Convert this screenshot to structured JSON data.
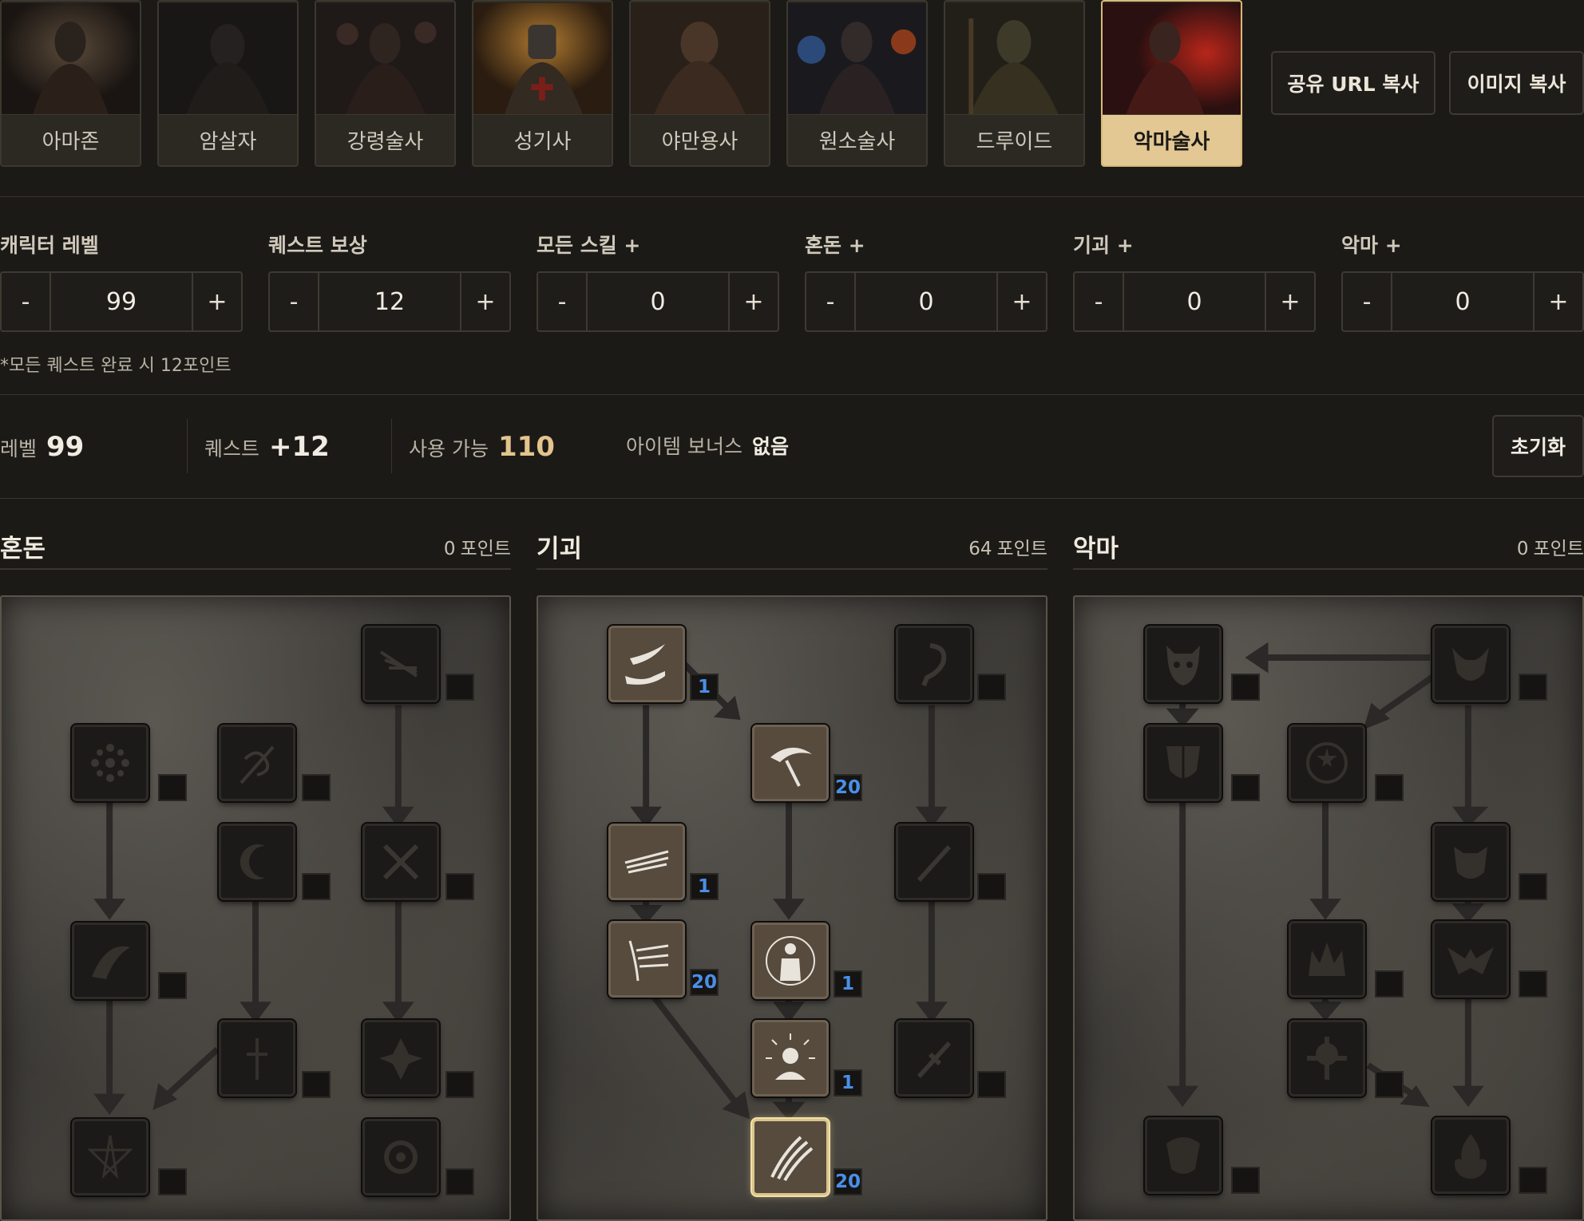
{
  "classes": [
    {
      "name": "아마존",
      "active": false
    },
    {
      "name": "암살자",
      "active": false
    },
    {
      "name": "강령술사",
      "active": false
    },
    {
      "name": "성기사",
      "active": false
    },
    {
      "name": "야만용사",
      "active": false
    },
    {
      "name": "원소술사",
      "active": false
    },
    {
      "name": "드루이드",
      "active": false
    },
    {
      "name": "악마술사",
      "active": true
    }
  ],
  "top_buttons": {
    "share_url": "공유 URL 복사",
    "copy_image": "이미지 복사"
  },
  "steppers": [
    {
      "label": "캐릭터 레벨",
      "value": "99"
    },
    {
      "label": "퀘스트 보상",
      "value": "12"
    },
    {
      "label": "모든 스킬 +",
      "value": "0"
    },
    {
      "label": "혼돈 +",
      "value": "0"
    },
    {
      "label": "기괴 +",
      "value": "0"
    },
    {
      "label": "악마 +",
      "value": "0"
    }
  ],
  "stepper_symbols": {
    "minus": "-",
    "plus": "+"
  },
  "note": "*모든 퀘스트 완료 시 12포인트",
  "summary": {
    "level_label": "레벨",
    "level_value": "99",
    "quest_label": "퀘스트",
    "quest_value": "+12",
    "available_label": "사용 가능",
    "available_value": "110",
    "item_bonus_label": "아이템 보너스",
    "item_bonus_value": "없음",
    "reset": "초기화"
  },
  "trees": [
    {
      "name": "혼돈",
      "points": "0",
      "points_unit": "포인트"
    },
    {
      "name": "기괴",
      "points": "64",
      "points_unit": "포인트"
    },
    {
      "name": "악마",
      "points": "0",
      "points_unit": "포인트"
    }
  ],
  "skill_points": {
    "grotesque": [
      "1",
      "20",
      "1",
      "20",
      "1",
      "1",
      "20"
    ]
  },
  "colors": {
    "accent": "#e3c894",
    "points_blue": "#4a8fe8",
    "background": "#1c1a16"
  }
}
